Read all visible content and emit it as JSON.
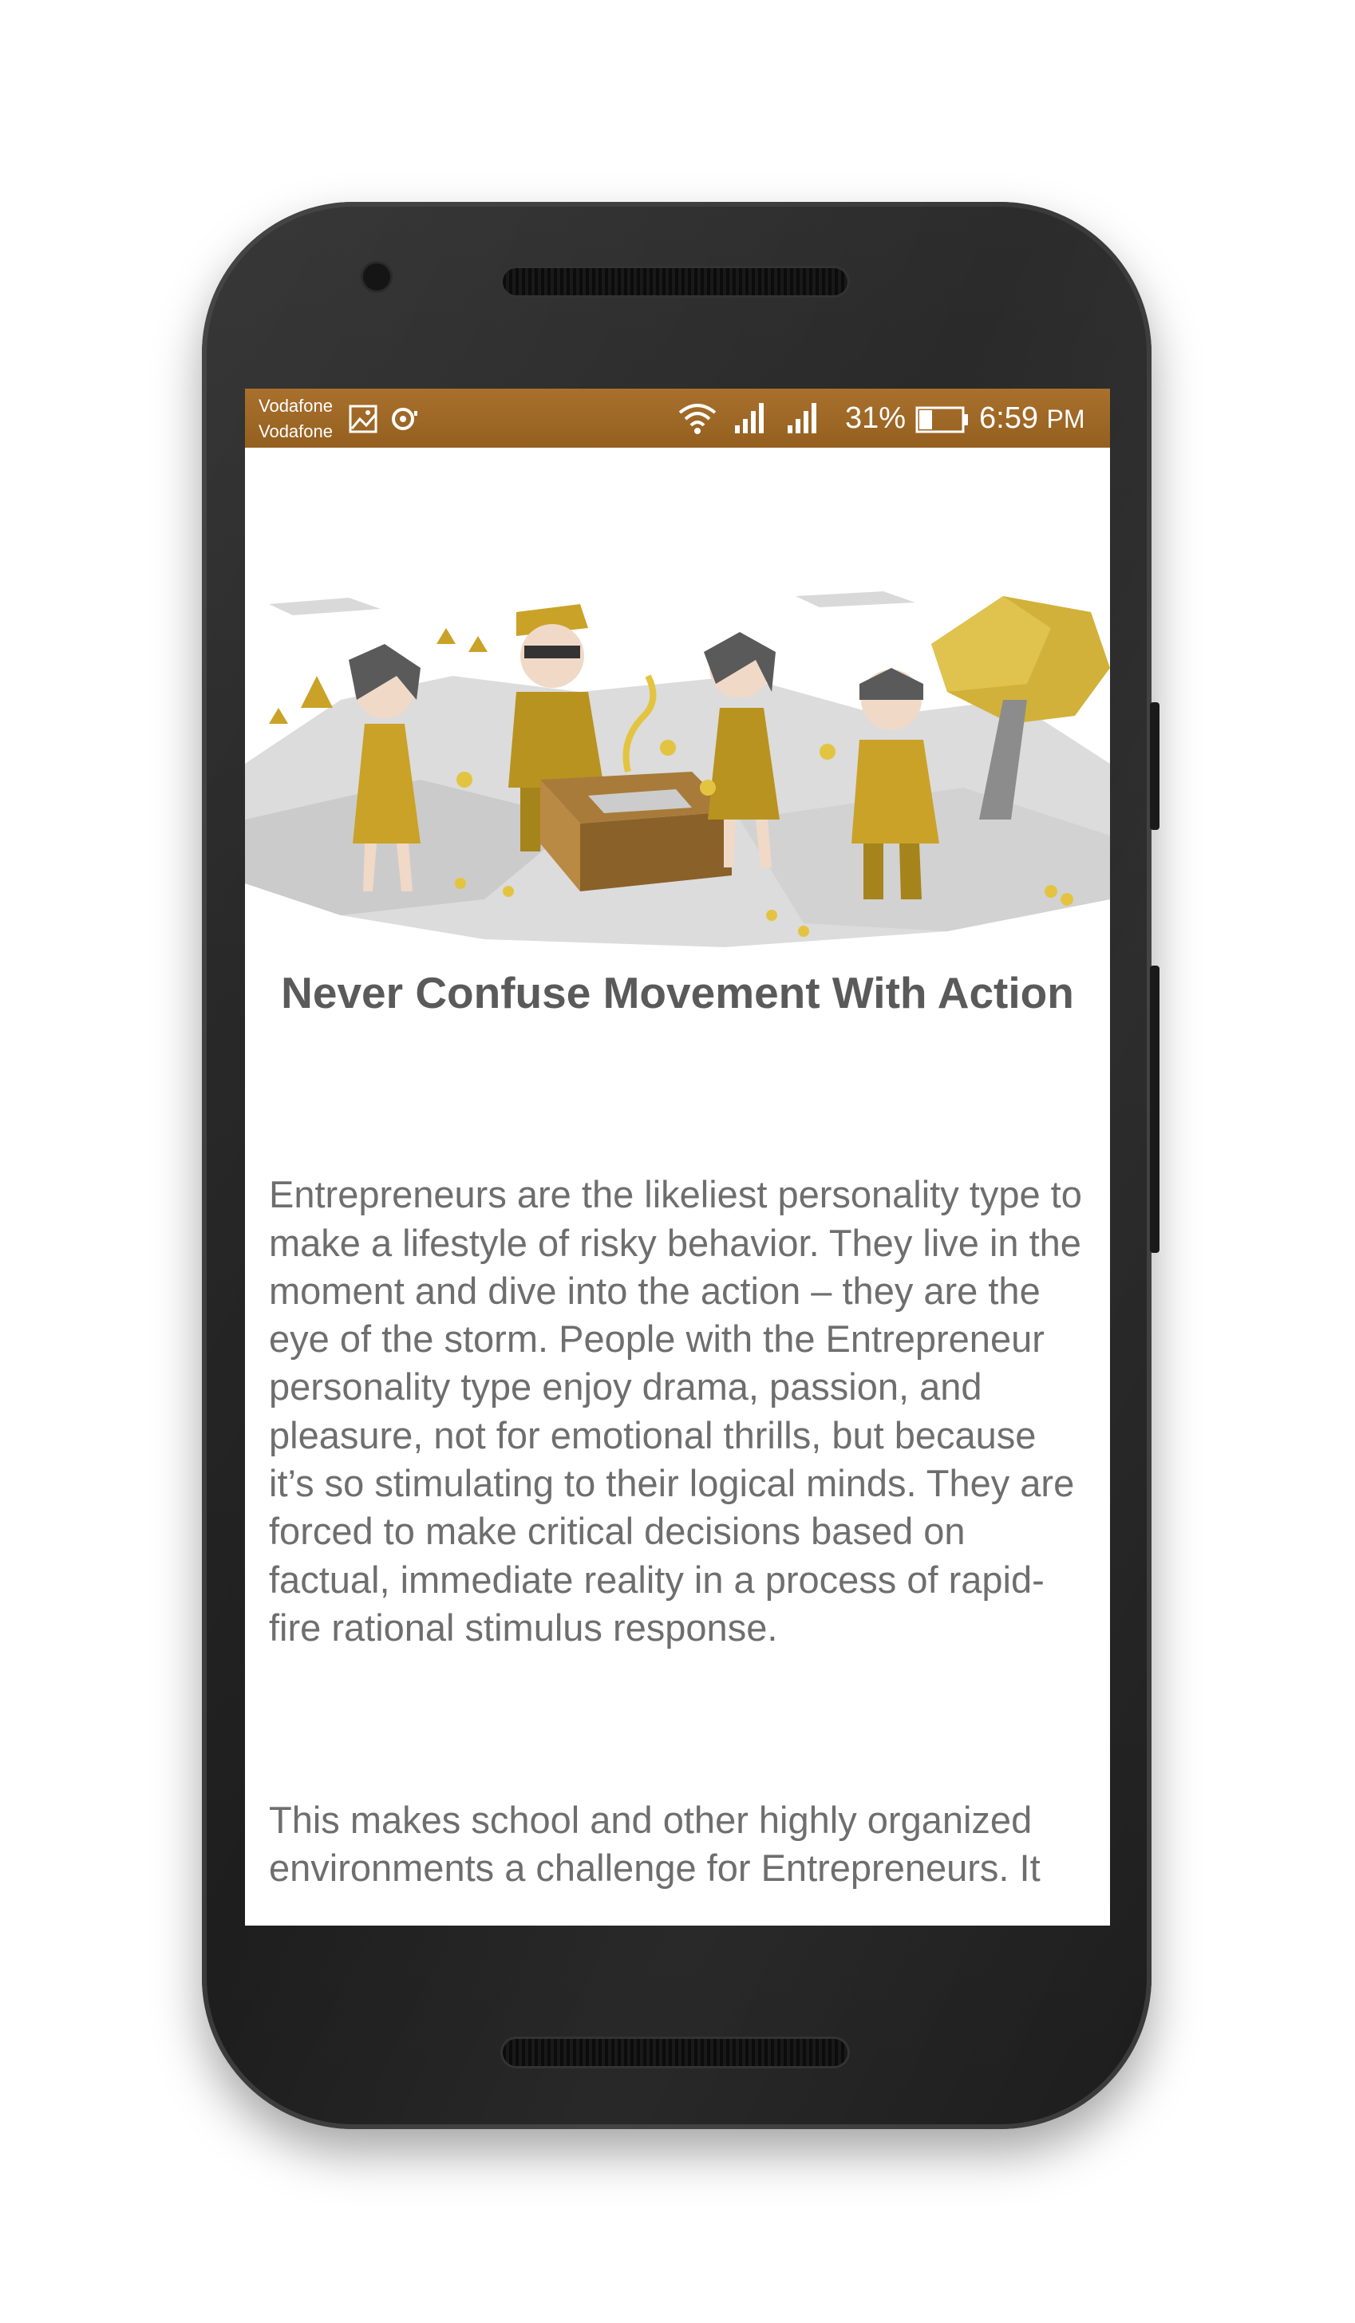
{
  "status_bar": {
    "carrier_1": "Vodafone",
    "carrier_2": "Vodafone",
    "battery": "31%",
    "time": "6:59",
    "time_suffix": "PM",
    "bar_color": "#a36a28"
  },
  "article": {
    "title": "Never Confuse Movement With Action",
    "paragraph_1": "Entrepreneurs are the likeliest personality type to make a lifestyle of risky behavior. They live in the moment and dive into the action – they are the eye of the storm. People with the Entrepreneur personality type enjoy drama, passion, and pleasure, not for emotional thrills, but because it’s so stimulating to their logical minds. They are forced to make critical decisions based on factual, immediate reality in a process of rapid-fire rational stimulus response.",
    "paragraph_2": "This makes school and other highly organized environments a challenge for Entrepreneurs. It certainly isn’t because they aren’t smart, and they can do well, but the"
  },
  "colors": {
    "accent_gold": "#c9a227",
    "title_text": "#5a5a5a",
    "body_text": "#6e6e6e"
  }
}
